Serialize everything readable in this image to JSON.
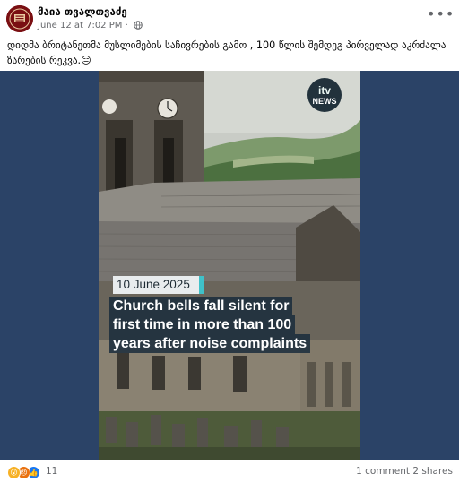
{
  "post": {
    "author": "მაია თვალთვაძე",
    "timestamp": "June 12 at 7:02 PM",
    "more_label": "•••",
    "text": "დიდმა ბრიტანეთმა მუსლიმების საჩივრების გამო , 100 წლის შემდეგ პირველად აკრძალა ზარების რეკვა.😑"
  },
  "video": {
    "channel_logo_line1": "itv",
    "channel_logo_line2": "NEWS",
    "date_badge": "10 June 2025",
    "caption_lines": [
      "Church bells fall silent for",
      "first time in more than 100",
      "years after noise complaints"
    ]
  },
  "engagement": {
    "reaction_count": "11",
    "comments": "1 comment",
    "shares": "2 shares",
    "reaction_icons": [
      "wow-icon",
      "angry-icon",
      "like-icon"
    ]
  },
  "colors": {
    "media_background": "#2b4367",
    "meta_text": "#65676b",
    "badge_accent": "#3fc1c9"
  }
}
